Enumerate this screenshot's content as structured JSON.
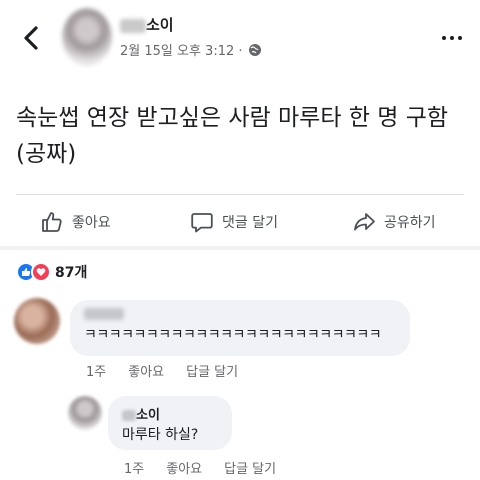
{
  "header": {
    "author_suffix": "소이",
    "timestamp": "2월 15일 오후 3:12 · ",
    "back_icon": "chevron-left-icon",
    "privacy_icon": "globe-icon",
    "more_icon": "more-dots-icon"
  },
  "post": {
    "text": "속눈썹 연장 받고싶은 사람 마루타 한 명 구함 (공짜)"
  },
  "actions": {
    "like": "좋아요",
    "comment": "댓글 달기",
    "share": "공유하기"
  },
  "reactions": {
    "count": "87개",
    "icons": [
      "thumbs-up-icon",
      "heart-icon"
    ]
  },
  "comments": [
    {
      "text": "ㅋㅋㅋㅋㅋㅋㅋㅋㅋㅋㅋㅋㅋㅋㅋㅋㅋㅋㅋㅋㅋㅋㅋㅋ",
      "time": "1주",
      "like": "좋아요",
      "reply": "답글 달기"
    },
    {
      "author_suffix": "소이",
      "text": "마루타 하실?",
      "time": "1주",
      "like": "좋아요",
      "reply": "답글 달기"
    }
  ],
  "colors": {
    "like_blue": "#1877f2",
    "love_red": "#f33e58",
    "bubble_bg": "#f0f2f5",
    "meta_gray": "#65676b"
  }
}
